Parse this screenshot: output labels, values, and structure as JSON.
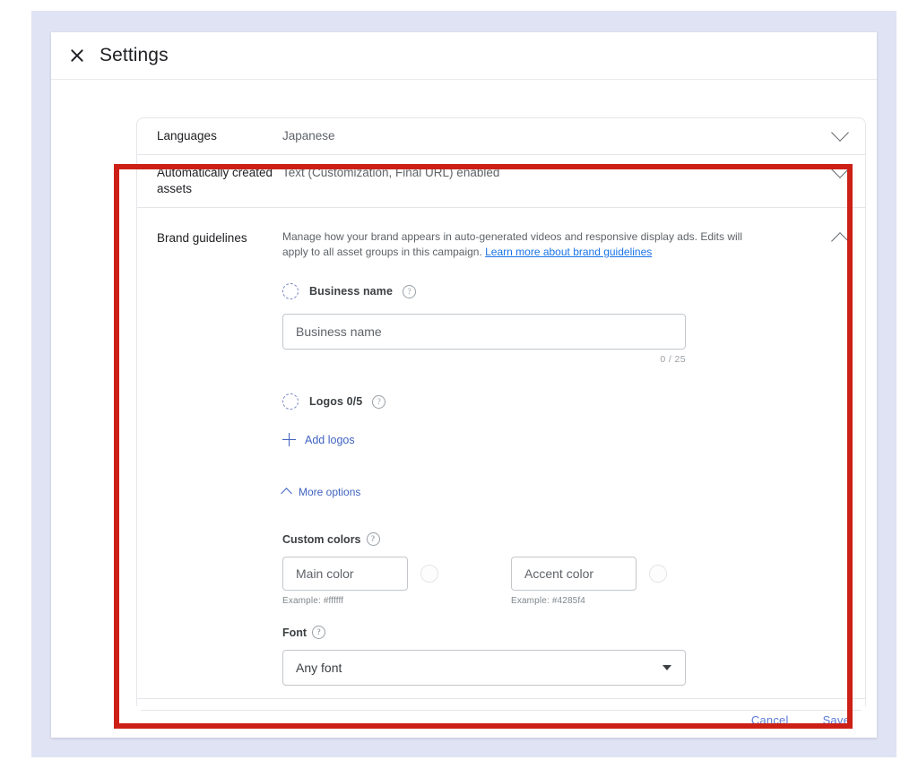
{
  "dialog": {
    "title": "Settings",
    "close_icon": "close-icon"
  },
  "settings_rows": [
    {
      "label": "Languages",
      "value": "Japanese",
      "chevron": "chevron-down-icon"
    },
    {
      "label": "Automatically created assets",
      "value": "Text (Customization, Final URL) enabled",
      "chevron": "chevron-down-icon"
    }
  ],
  "brand_guidelines": {
    "label": "Brand guidelines",
    "chevron": "chevron-up-icon",
    "description_line1": "Manage how your brand appears in auto-generated videos and responsive display ads.",
    "description_line2": "Edits will apply to all asset groups in this campaign. ",
    "learn_more_link": "Learn more about brand guidelines",
    "business_name": {
      "section_label": "Business name",
      "status_icon": "dashed-circle-icon",
      "help_icon": "help-icon",
      "placeholder": "Business name",
      "value": "",
      "counter": "0 / 25"
    },
    "logos": {
      "section_label": "Logos 0/5",
      "status_icon": "dashed-circle-icon",
      "help_icon": "help-icon",
      "add_label": "Add logos",
      "add_icon": "plus-icon"
    },
    "more_options": {
      "label": "More options",
      "icon": "chevron-up-icon"
    },
    "custom_colors": {
      "label": "Custom colors",
      "help_icon": "help-icon",
      "main": {
        "placeholder": "Main color",
        "value": "",
        "example": "Example: #ffffff",
        "swatch": "#ffffff"
      },
      "accent": {
        "placeholder": "Accent color",
        "value": "",
        "example": "Example: #4285f4",
        "swatch": "#4285f4"
      }
    },
    "font": {
      "label": "Font",
      "help_icon": "help-icon",
      "selected": "Any font",
      "caret_icon": "caret-down-icon"
    }
  },
  "footer": {
    "cancel_label": "Cancel",
    "save_label": "Save"
  },
  "annotation": {
    "highlight_color": "#cc2017"
  }
}
